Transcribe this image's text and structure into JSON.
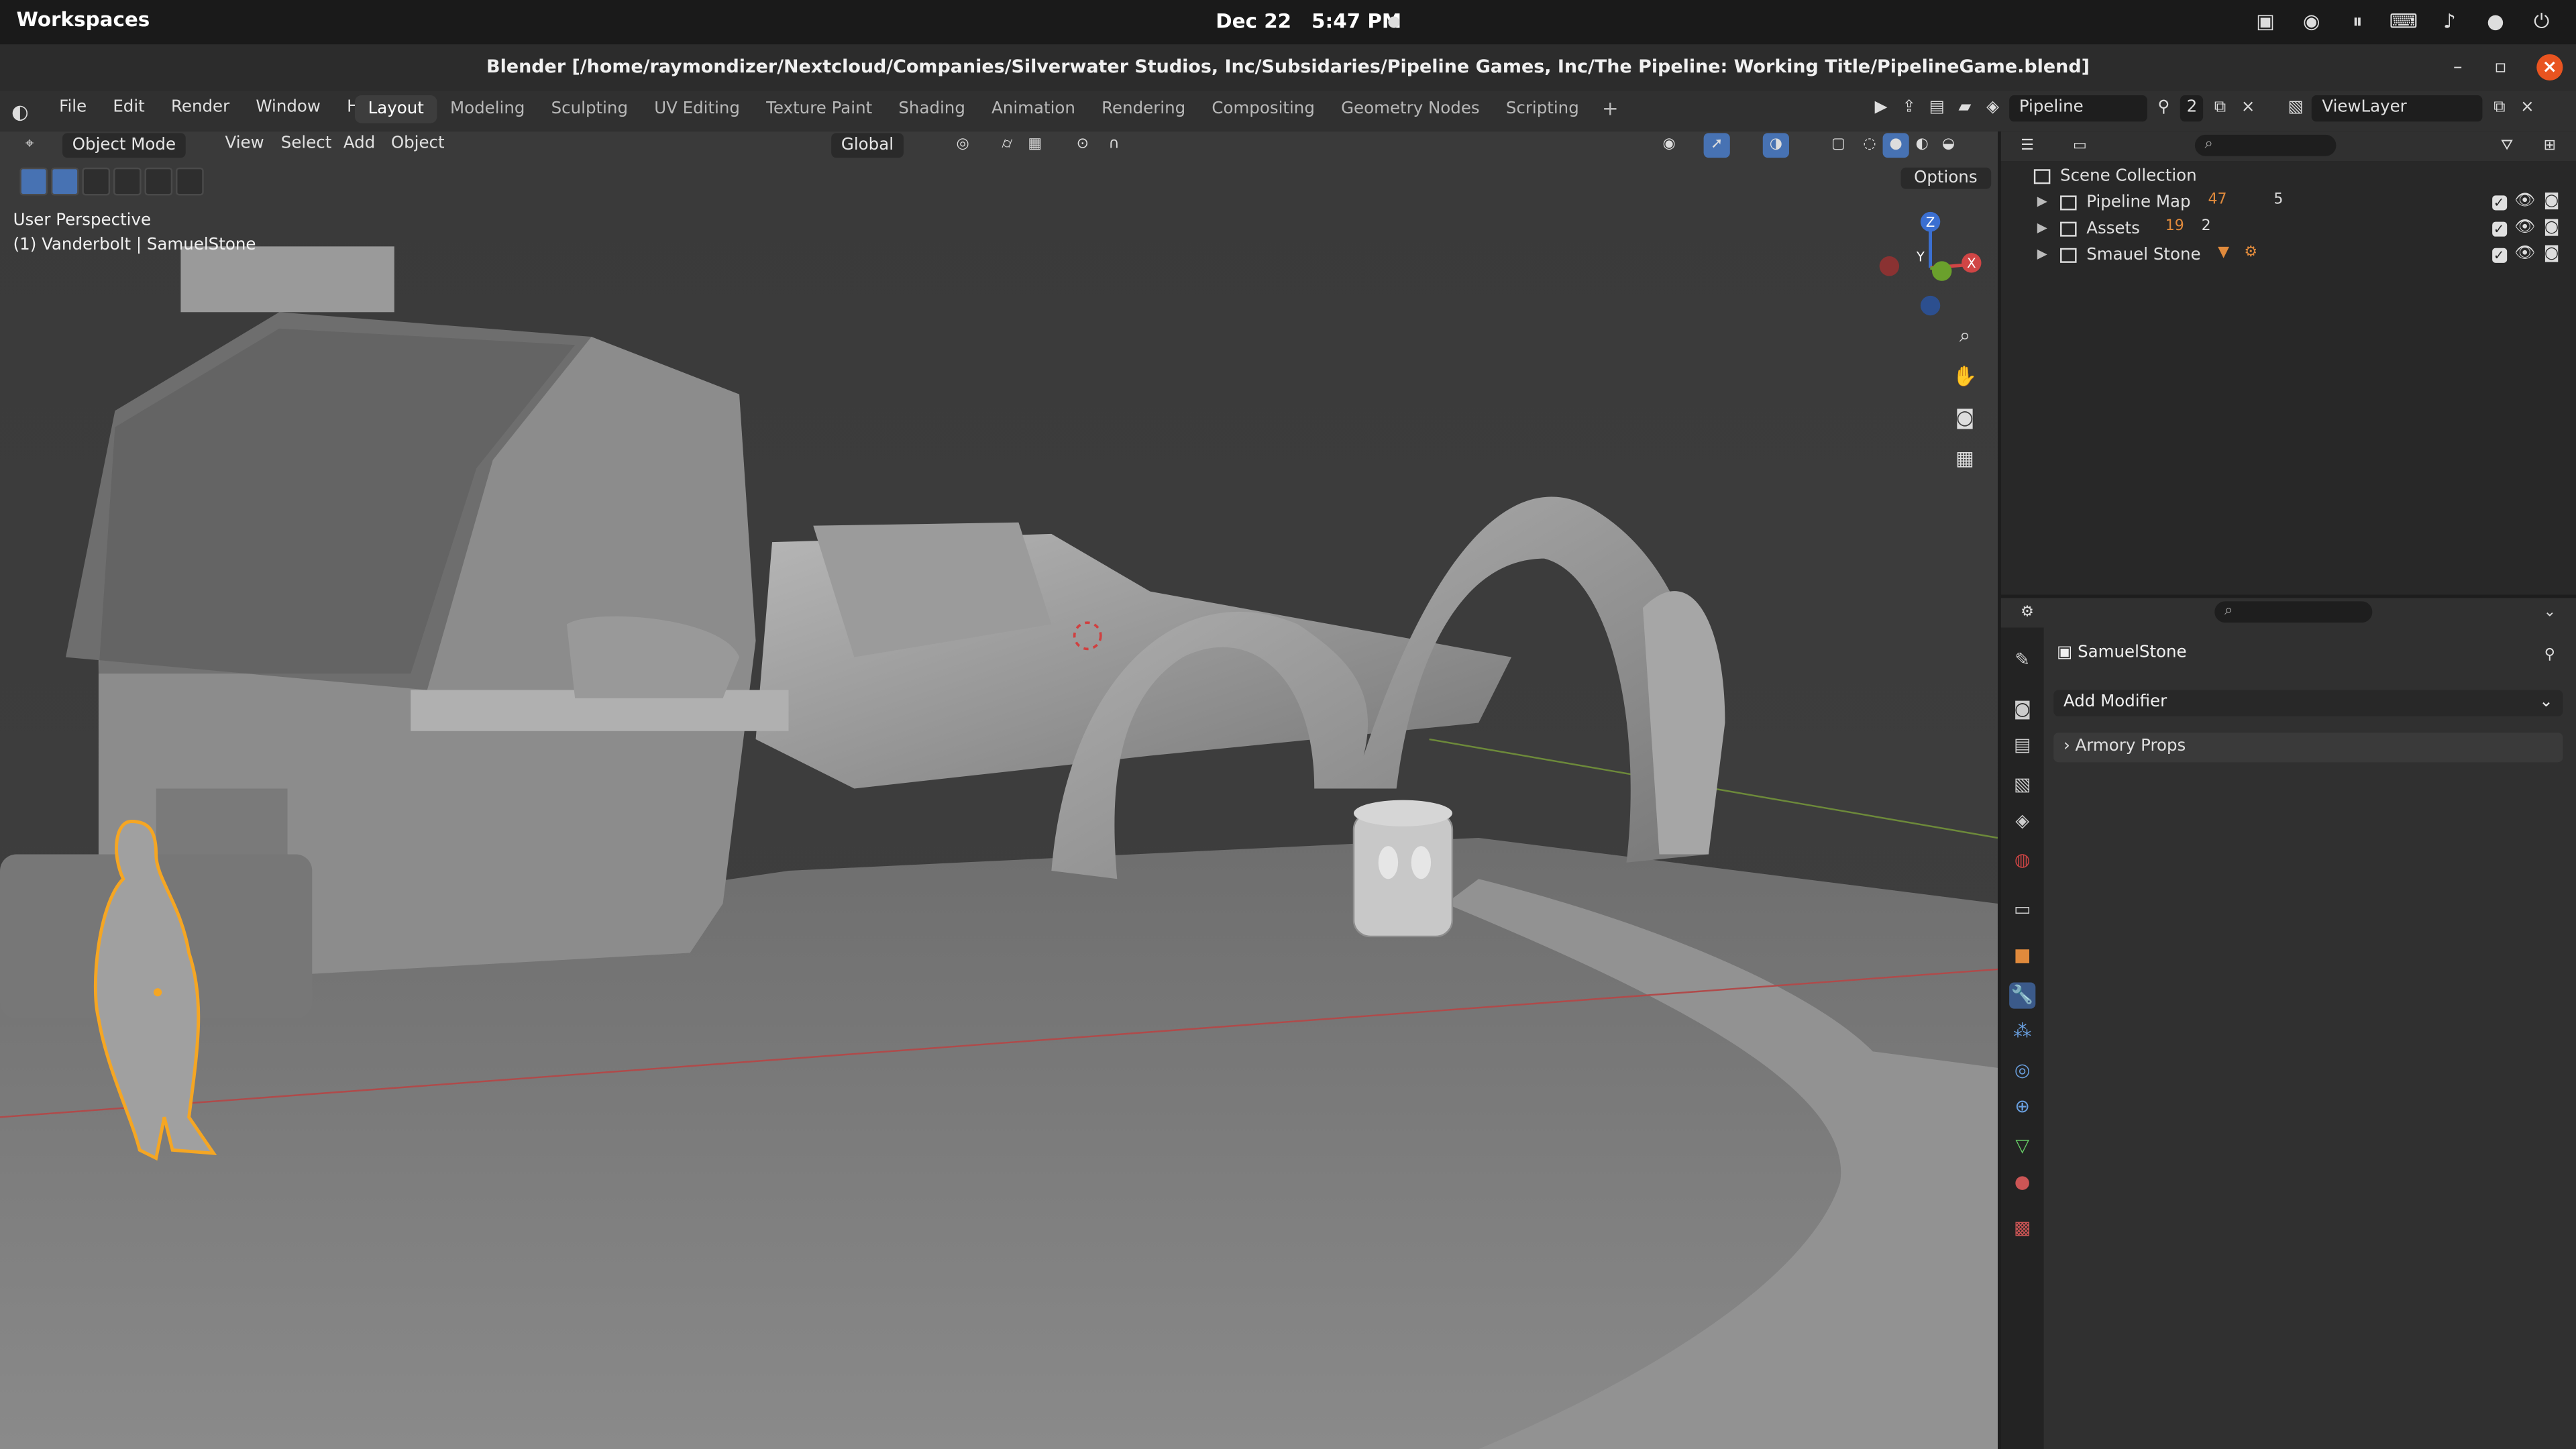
{
  "gnome": {
    "activities": "Workspaces",
    "date": "Dec 22",
    "time": "5:47 PM"
  },
  "window": {
    "title": "Blender [/home/raymondizer/Nextcloud/Companies/Silverwater Studios, Inc/Subsidaries/Pipeline Games, Inc/The Pipeline: Working Title/PipelineGame.blend]"
  },
  "menu": {
    "file": "File",
    "edit": "Edit",
    "render": "Render",
    "window": "Window",
    "help": "Help"
  },
  "workspaces": [
    "Layout",
    "Modeling",
    "Sculpting",
    "UV Editing",
    "Texture Paint",
    "Shading",
    "Animation",
    "Rendering",
    "Compositing",
    "Geometry Nodes",
    "Scripting"
  ],
  "scene": {
    "name": "Pipeline",
    "users": "2",
    "view_layer": "ViewLayer"
  },
  "viewport": {
    "mode": "Object Mode",
    "view": "View",
    "select": "Select",
    "add": "Add",
    "object": "Object",
    "orientation": "Global",
    "options": "Options",
    "perspective": "User Perspective",
    "active": "(1) Vanderbolt | SamuelStone",
    "axis_x": "X",
    "axis_y": "Y",
    "axis_z": "Z"
  },
  "outliner": {
    "root": "Scene Collection",
    "items": [
      {
        "label": "Pipeline Map",
        "badge1": "47",
        "badge2": "5"
      },
      {
        "label": "Assets",
        "badge1": "19",
        "badge2": "2"
      },
      {
        "label": "Smauel Stone",
        "badge1": "",
        "badge2": ""
      }
    ]
  },
  "properties": {
    "object_name": "SamuelStone",
    "add_modifier": "Add Modifier",
    "panel": "Armory Props"
  },
  "colors": {
    "accent": "#4772b3",
    "selection": "#f5a623",
    "close": "#e95420"
  }
}
